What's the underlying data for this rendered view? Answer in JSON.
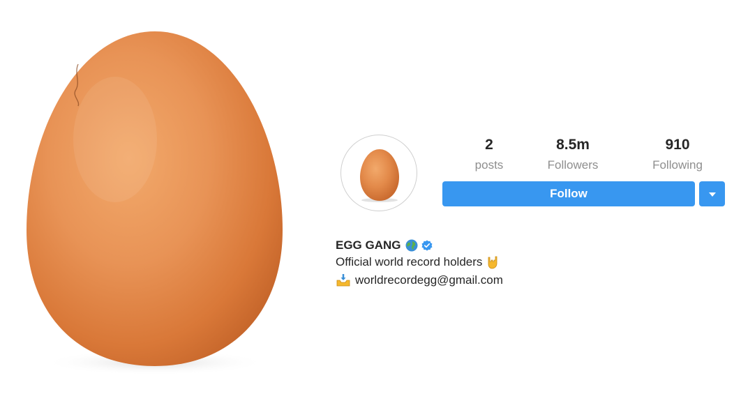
{
  "profile": {
    "stats": {
      "posts": {
        "count": "2",
        "label": "posts"
      },
      "followers": {
        "count": "8.5m",
        "label": "Followers"
      },
      "following": {
        "count": "910",
        "label": "Following"
      }
    },
    "follow_label": "Follow",
    "name": "EGG GANG",
    "name_icons": [
      "globe-icon",
      "verified-icon"
    ],
    "bio_line_1": "Official world record holders",
    "bio_line_1_icon": "rock-hand-icon",
    "email_icon": "inbox-tray-icon",
    "email": "worldrecordegg@gmail.com"
  },
  "colors": {
    "accent": "#3897f0",
    "text": "#262626",
    "muted": "#8e8e8e",
    "verified": "#3897f0",
    "egg": "#e38a4a"
  }
}
